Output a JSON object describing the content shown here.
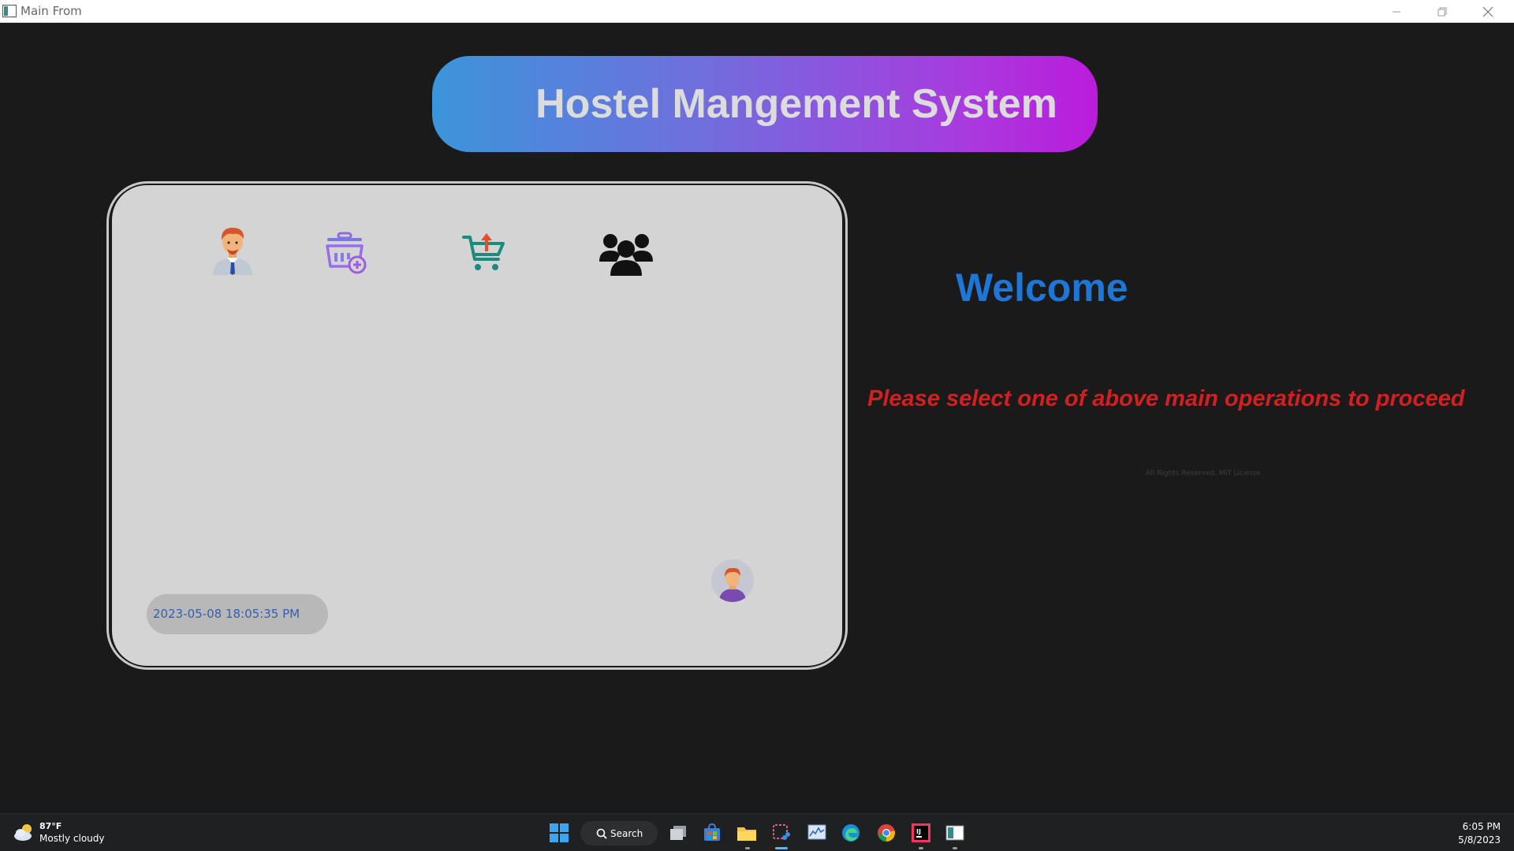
{
  "window": {
    "title": "Main From"
  },
  "header": {
    "title": "Hostel Mangement System"
  },
  "operations": [
    {
      "name": "employee",
      "icon": "employee-icon"
    },
    {
      "name": "add-basket",
      "icon": "basket-add-icon"
    },
    {
      "name": "cart",
      "icon": "shopping-cart-icon"
    },
    {
      "name": "group",
      "icon": "users-group-icon"
    }
  ],
  "status": {
    "datetime": "2023-05-08  18:05:35 PM"
  },
  "main": {
    "welcome": "Welcome",
    "prompt": "Please select one of above main operations to proceed",
    "rights": "All Rights Reserved. MIT License."
  },
  "taskbar": {
    "weather_temp": "87°F",
    "weather_desc": "Mostly cloudy",
    "search_label": "Search",
    "clock_time": "6:05 PM",
    "clock_date": "5/8/2023"
  },
  "colors": {
    "background": "#1a1a1b",
    "card": "#d4d4d5",
    "banner_start": "#3b95da",
    "banner_end": "#bb1bdb",
    "welcome": "#1e76d6",
    "prompt": "#d22020",
    "datetime_text": "#2f5fb8"
  }
}
